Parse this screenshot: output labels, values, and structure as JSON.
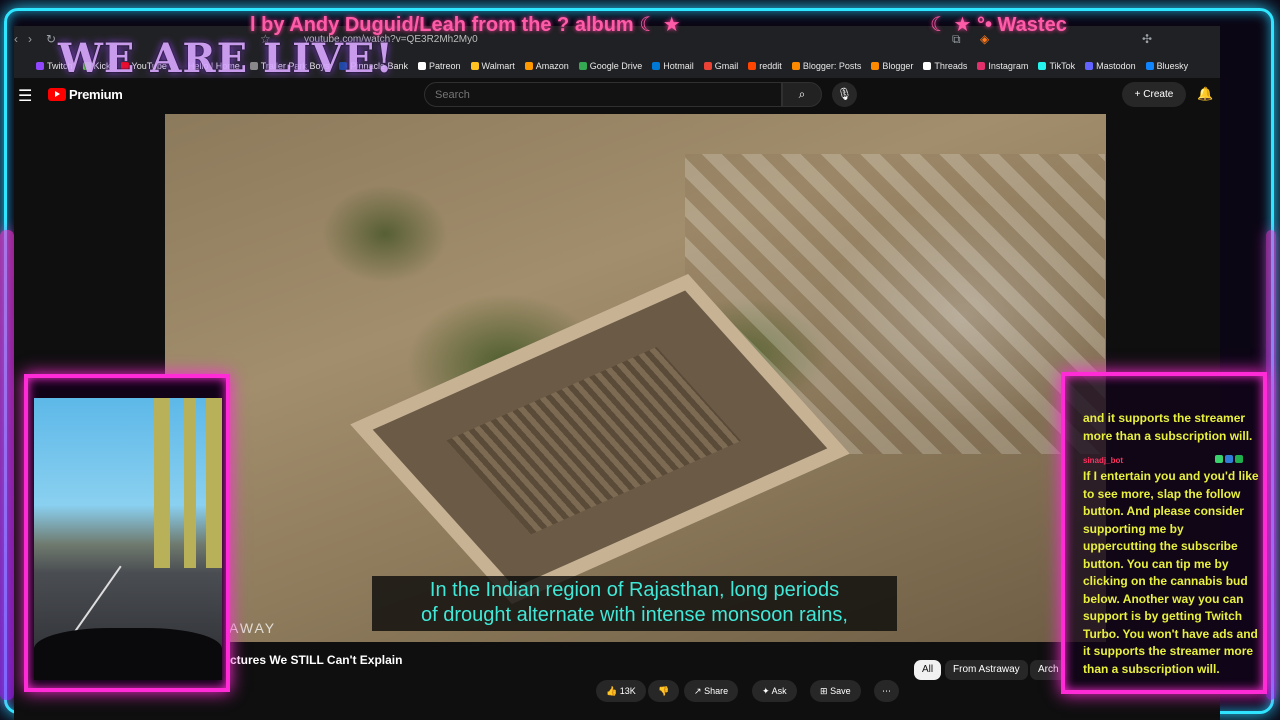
{
  "overlay": {
    "ticker_text": "l by Andy Duguid/Leah from the ? album  ☾  ★",
    "ticker_text_2": "☾  ★ °• Wastec",
    "live_banner": "WE ARE LIVE!"
  },
  "browser": {
    "url": "youtube.com/watch?v=QE3R2Mh2My0",
    "bookmarks": [
      {
        "label": "Twitch",
        "color": "#9146ff"
      },
      {
        "label": "Kick",
        "color": "#53fc18"
      },
      {
        "label": "YouTube",
        "color": "#ff0000"
      },
      {
        "label": "Hello | Home",
        "color": "#222222"
      },
      {
        "label": "Trailer Park Boys",
        "color": "#888888"
      },
      {
        "label": "Pinnacle Bank",
        "color": "#1a4aa0"
      },
      {
        "label": "Patreon",
        "color": "#ffffff"
      },
      {
        "label": "Walmart",
        "color": "#ffc220"
      },
      {
        "label": "Amazon",
        "color": "#ff9900"
      },
      {
        "label": "Google Drive",
        "color": "#34a853"
      },
      {
        "label": "Hotmail",
        "color": "#0078d4"
      },
      {
        "label": "Gmail",
        "color": "#ea4335"
      },
      {
        "label": "reddit",
        "color": "#ff4500"
      },
      {
        "label": "Blogger: Posts",
        "color": "#ff8a00"
      },
      {
        "label": "Blogger",
        "color": "#ff8a00"
      },
      {
        "label": "Threads",
        "color": "#ffffff"
      },
      {
        "label": "Instagram",
        "color": "#e1306c"
      },
      {
        "label": "TikTok",
        "color": "#25f4ee"
      },
      {
        "label": "Mastodon",
        "color": "#6364ff"
      },
      {
        "label": "Bluesky",
        "color": "#1185fe"
      }
    ]
  },
  "youtube": {
    "logo_text": "Premium",
    "search_placeholder": "Search",
    "create_label": "Create",
    "video": {
      "watermark": "AWAY",
      "subtitle_line1": "In the Indian region of Rajasthan, long periods",
      "subtitle_line2": "of drought alternate with intense monsoon rains,",
      "title": "ctures We STILL Can't Explain"
    },
    "chips": [
      "All",
      "From Astraway",
      "Arch"
    ],
    "actions": {
      "likes": "13K",
      "share": "Share",
      "ask": "Ask",
      "save": "Save"
    }
  },
  "chat": {
    "message_1": "and it supports the streamer more than a subscription will.",
    "username": "sinadj_bot",
    "message_2": "If I entertain you and you'd like to see more, slap the follow button. And please consider supporting me by uppercutting the subscribe button. You can tip me by clicking on the cannabis bud below. Another way you can support is by getting Twitch Turbo. You won't have ads and it supports the streamer more than a subscription will."
  }
}
